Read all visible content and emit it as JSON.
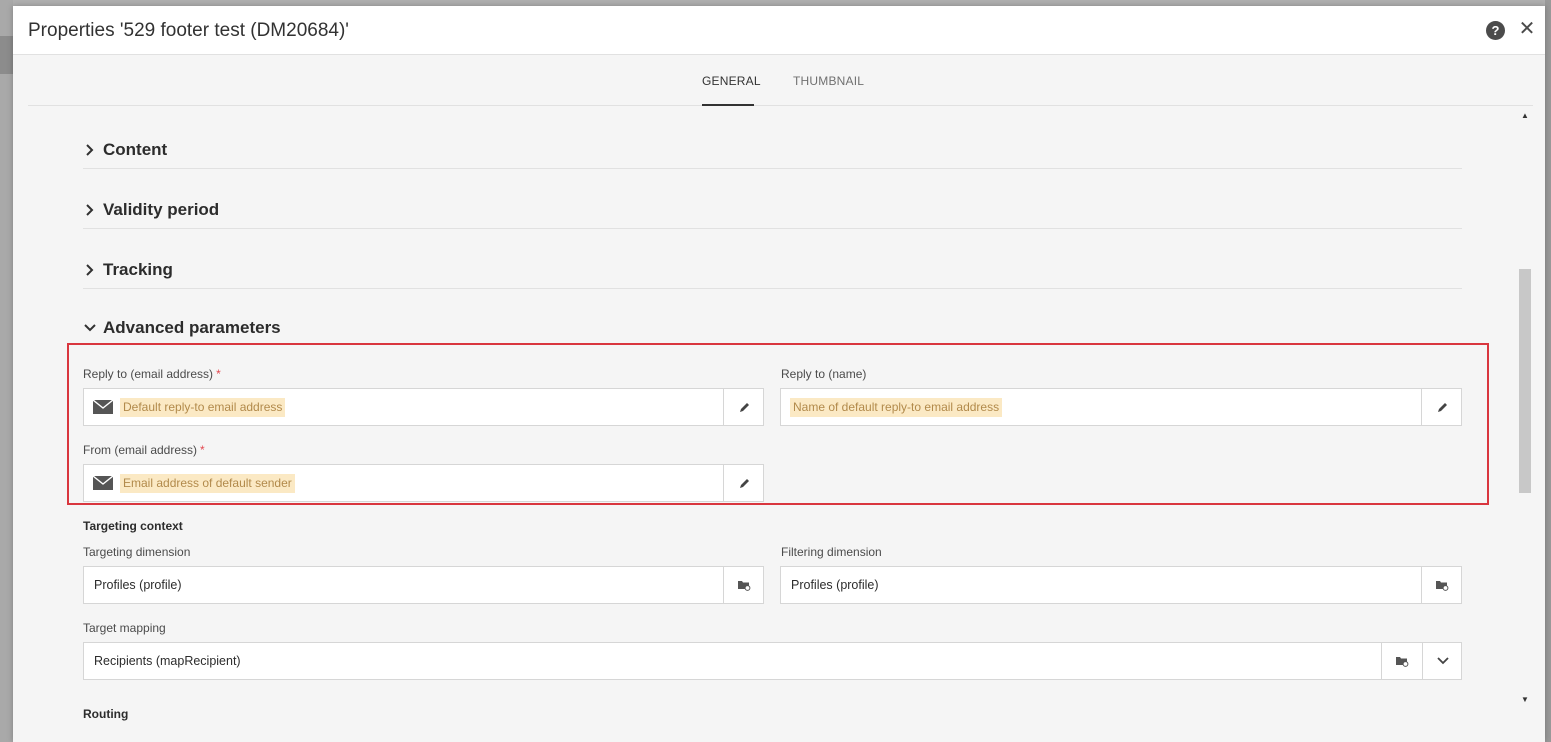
{
  "dialog": {
    "title": "Properties '529 footer test (DM20684)'",
    "help_icon": "?",
    "close_icon": "✕"
  },
  "tabs": [
    {
      "label": "GENERAL",
      "active": true
    },
    {
      "label": "THUMBNAIL",
      "active": false
    }
  ],
  "sections": [
    {
      "title": "Content",
      "expanded": false
    },
    {
      "title": "Validity period",
      "expanded": false
    },
    {
      "title": "Tracking",
      "expanded": false
    },
    {
      "title": "Advanced parameters",
      "expanded": true
    }
  ],
  "advanced": {
    "reply_to_email": {
      "label": "Reply to (email address)",
      "required_mark": "*",
      "placeholder": "Default reply-to email address"
    },
    "reply_to_name": {
      "label": "Reply to (name)",
      "placeholder": "Name of default reply-to email address"
    },
    "from_email": {
      "label": "From (email address)",
      "required_mark": "*",
      "placeholder": "Email address of default sender"
    }
  },
  "targeting": {
    "title": "Targeting context",
    "targeting_dimension": {
      "label": "Targeting dimension",
      "value": "Profiles (profile)"
    },
    "filtering_dimension": {
      "label": "Filtering dimension",
      "value": "Profiles (profile)"
    },
    "target_mapping": {
      "label": "Target mapping",
      "value": "Recipients (mapRecipient)"
    }
  },
  "routing": {
    "title": "Routing"
  },
  "colors": {
    "highlight_frame": "#d9363e",
    "placeholder_bg": "#fbe9c4",
    "required": "#e34850"
  },
  "icons": {
    "mail": "envelope-icon",
    "edit": "pencil-icon",
    "browse": "folder-icon",
    "dropdown": "chevron-down-icon",
    "section_collapsed": "chevron-right-icon",
    "section_expanded": "chevron-down-icon"
  }
}
